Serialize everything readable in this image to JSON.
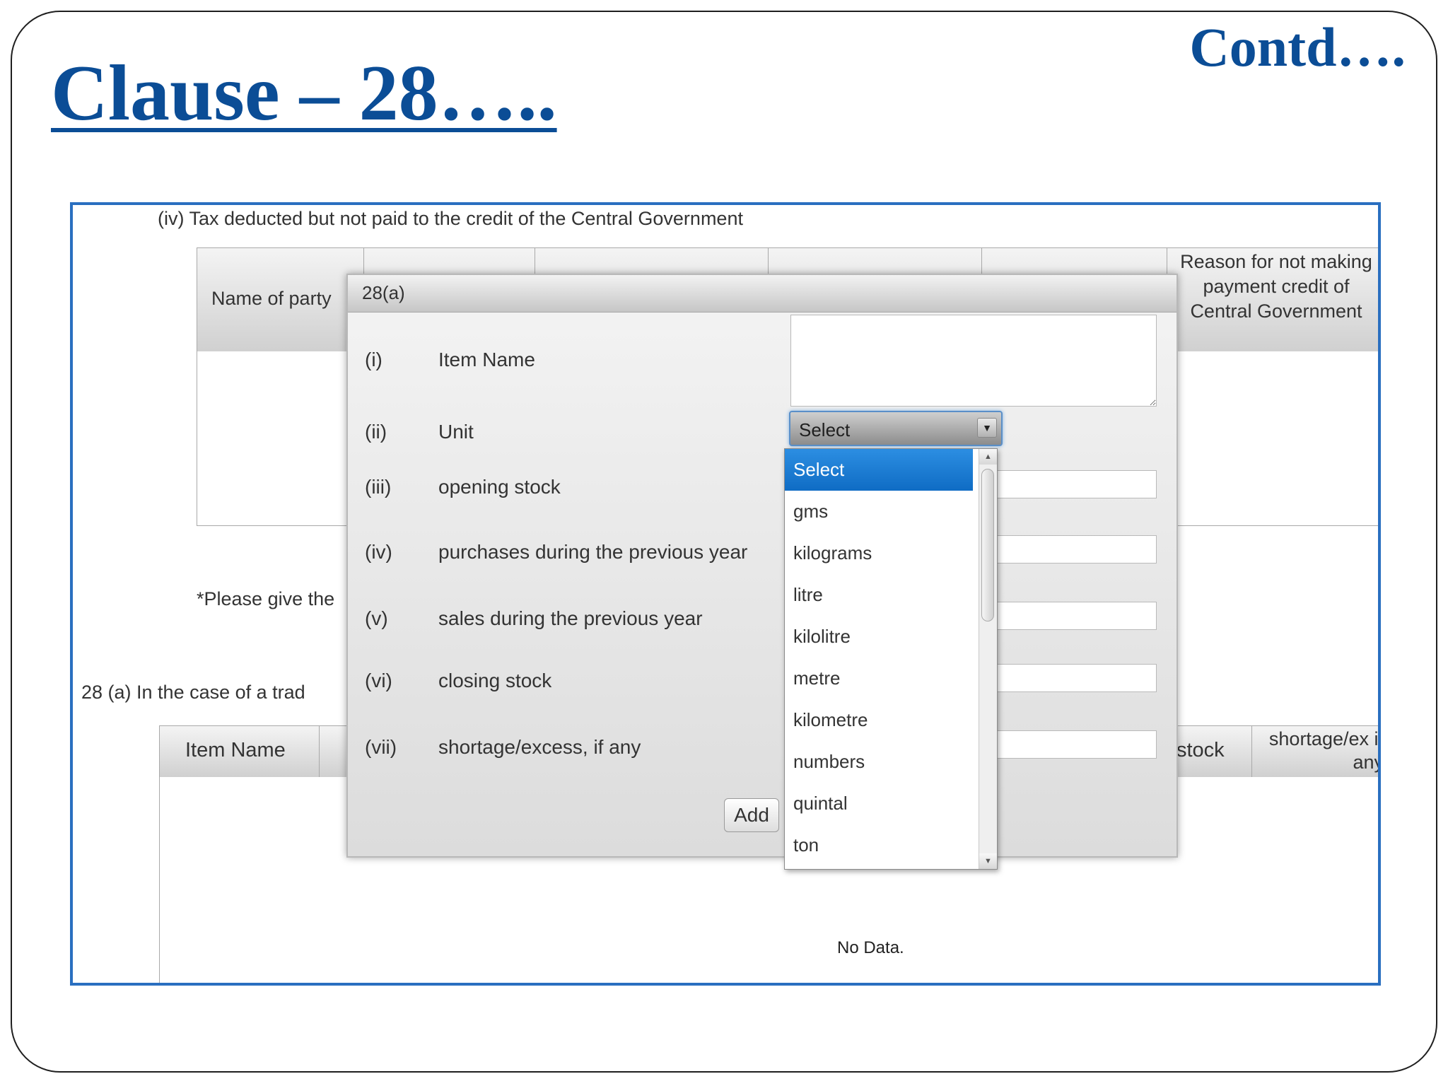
{
  "slide": {
    "title": "Clause – 28…..",
    "contd": "Contd…."
  },
  "background": {
    "section_iv_heading": "(iv) Tax deducted but not paid to the credit of the Central Government",
    "grid1_headers": [
      "Name of party",
      "Reason for not making payment credit of Central Government"
    ],
    "note": "*Please give the",
    "section_28a": "28  (a)  In the case  of a trad",
    "grid2_headers": [
      "Item Name",
      "stock",
      "shortage/ex if any"
    ],
    "no_data": "No Data."
  },
  "dialog": {
    "title": "28(a)",
    "rows": [
      {
        "num": "(i)",
        "label": "Item Name"
      },
      {
        "num": "(ii)",
        "label": "Unit"
      },
      {
        "num": "(iii)",
        "label": "opening stock"
      },
      {
        "num": "(iv)",
        "label": "purchases during the previous year"
      },
      {
        "num": "(v)",
        "label": "sales during the previous year"
      },
      {
        "num": "(vi)",
        "label": "closing stock"
      },
      {
        "num": "(vii)",
        "label": "shortage/excess, if any"
      }
    ],
    "unit_select": {
      "value": "Select"
    },
    "add_label": "Add"
  },
  "dropdown": {
    "options": [
      "Select",
      "gms",
      "kilograms",
      "litre",
      "kilolitre",
      "metre",
      "kilometre",
      "numbers",
      "quintal",
      "ton"
    ],
    "selected_index": 0
  },
  "colors": {
    "title_blue": "#0b4d96",
    "frame_blue": "#2a6fc0",
    "highlight_blue": "#1a7ad4"
  }
}
